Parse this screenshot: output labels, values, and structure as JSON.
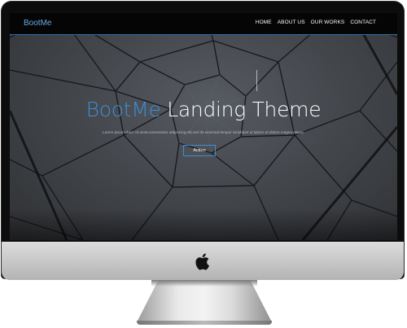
{
  "navbar": {
    "brand": "BootMe",
    "links": [
      "HOME",
      "ABOUT US",
      "OUR WORKS",
      "CONTACT"
    ]
  },
  "hero": {
    "title_highlight": "BootMe",
    "title_rest": "Landing Theme",
    "subtitle": "Lorem ipsum dolor sit amet,consectetur adipiscing elit,sed do eiusmod tempor incididunt ut labore et dolore magna aliqua.",
    "button_label": "Action"
  },
  "colors": {
    "accent": "#3d8ed6",
    "navbar_bg": "#050505",
    "screen_bg": "#44474c"
  },
  "icons": [
    "apple-logo-icon"
  ]
}
